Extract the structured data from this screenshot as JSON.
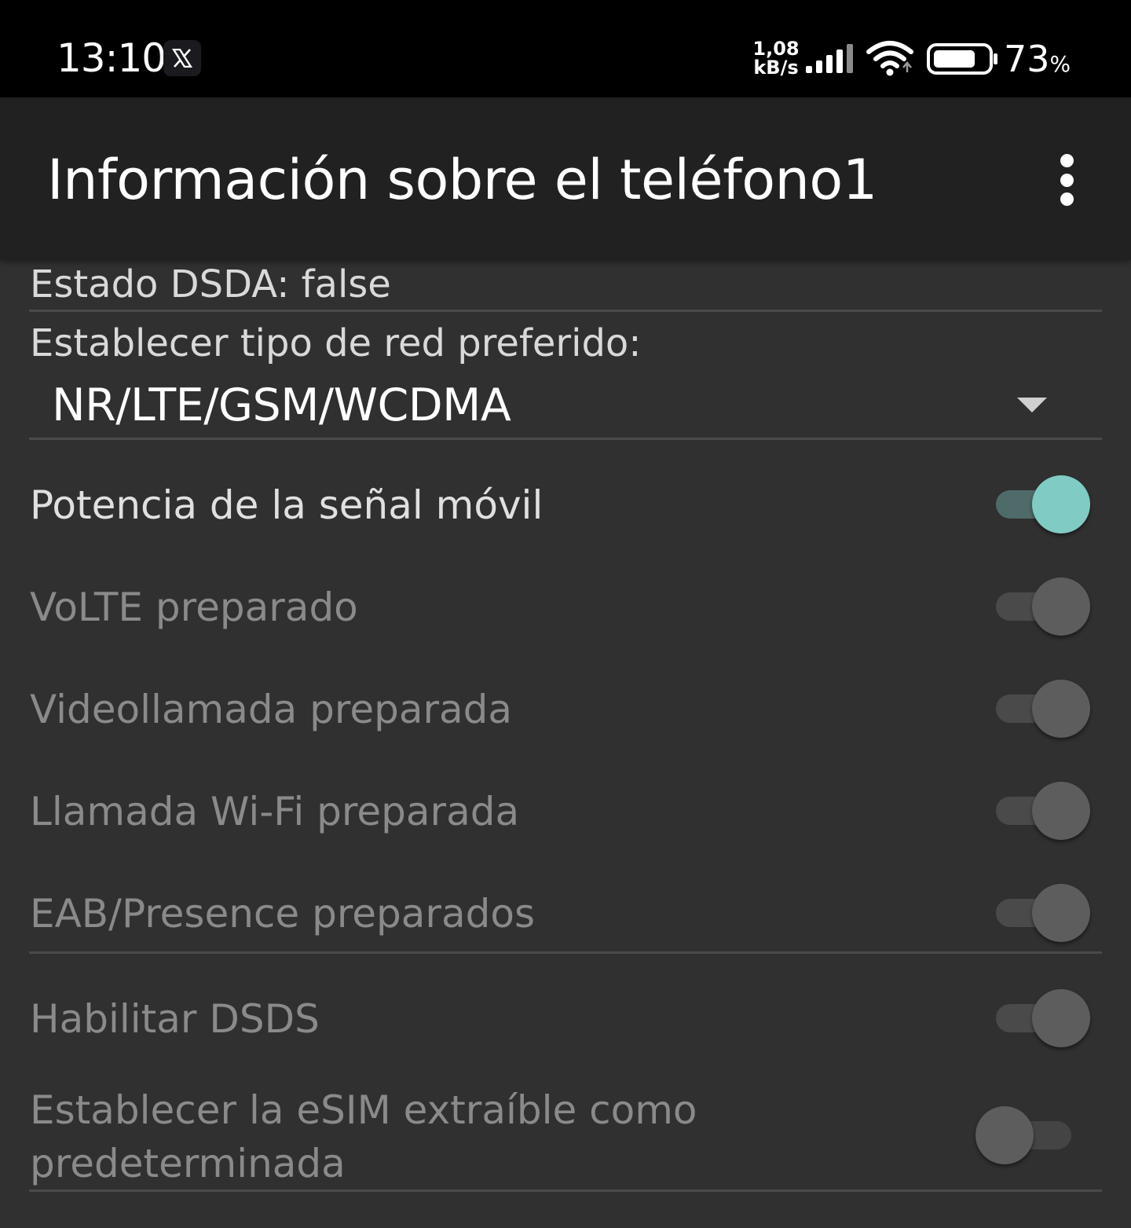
{
  "status_bar": {
    "time": "13:10",
    "notification_icon": "x-logo-icon",
    "net_speed_value": "1,08",
    "net_speed_unit": "kB/s",
    "battery_percent": "73",
    "battery_unit": "%",
    "battery_level": 0.73
  },
  "app_bar": {
    "title": "Información sobre el teléfono1",
    "menu_icon": "overflow-menu-icon"
  },
  "content": {
    "dsda_status": "Estado DSDA: false",
    "network_type_label": "Establecer tipo de red preferido:",
    "network_type_value": "NR/LTE/GSM/WCDMA",
    "switches": [
      {
        "label": "Potencia de la señal móvil",
        "checked": true,
        "enabled": true
      },
      {
        "label": "VoLTE preparado",
        "checked": true,
        "enabled": false
      },
      {
        "label": "Videollamada preparada",
        "checked": true,
        "enabled": false
      },
      {
        "label": "Llamada Wi-Fi preparada",
        "checked": true,
        "enabled": false
      },
      {
        "label": "EAB/Presence preparados",
        "checked": true,
        "enabled": false
      },
      {
        "label": "Habilitar DSDS",
        "checked": true,
        "enabled": false
      },
      {
        "label_line1": "Establecer la eSIM extraíble como",
        "label_line2": "predeterminada",
        "checked": false,
        "enabled": false
      }
    ]
  },
  "colors": {
    "background": "#303030",
    "app_bar": "#212121",
    "accent": "#80cbc4",
    "text_primary": "#ffffff",
    "text_secondary": "#d9d9d9",
    "text_disabled": "#8a8a8a"
  }
}
